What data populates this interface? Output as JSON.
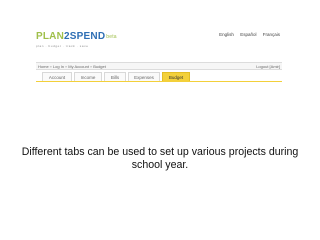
{
  "app": {
    "logo_plan": "PLAN",
    "logo_two": "2",
    "logo_spend": "SPEND",
    "logo_beta": "beta",
    "tagline": "plan · budget · track · save"
  },
  "header": {
    "languages": [
      "English",
      "Español",
      "Français"
    ]
  },
  "breadcrumb": {
    "items": [
      "Home",
      "Log In",
      "My Account",
      "Budget"
    ],
    "logout_label": "Logout [Amir]"
  },
  "tabs": {
    "items": [
      {
        "label": "Account"
      },
      {
        "label": "Income"
      },
      {
        "label": "Bills"
      },
      {
        "label": "Expenses"
      },
      {
        "label": "Budget"
      }
    ],
    "active_index": 4
  },
  "caption": {
    "text": "Different tabs can be used to set up various projects during school year."
  },
  "colors": {
    "accent_tab": "#f3d03a",
    "logo_green": "#9fbf4a",
    "logo_blue": "#2f6fb4"
  }
}
